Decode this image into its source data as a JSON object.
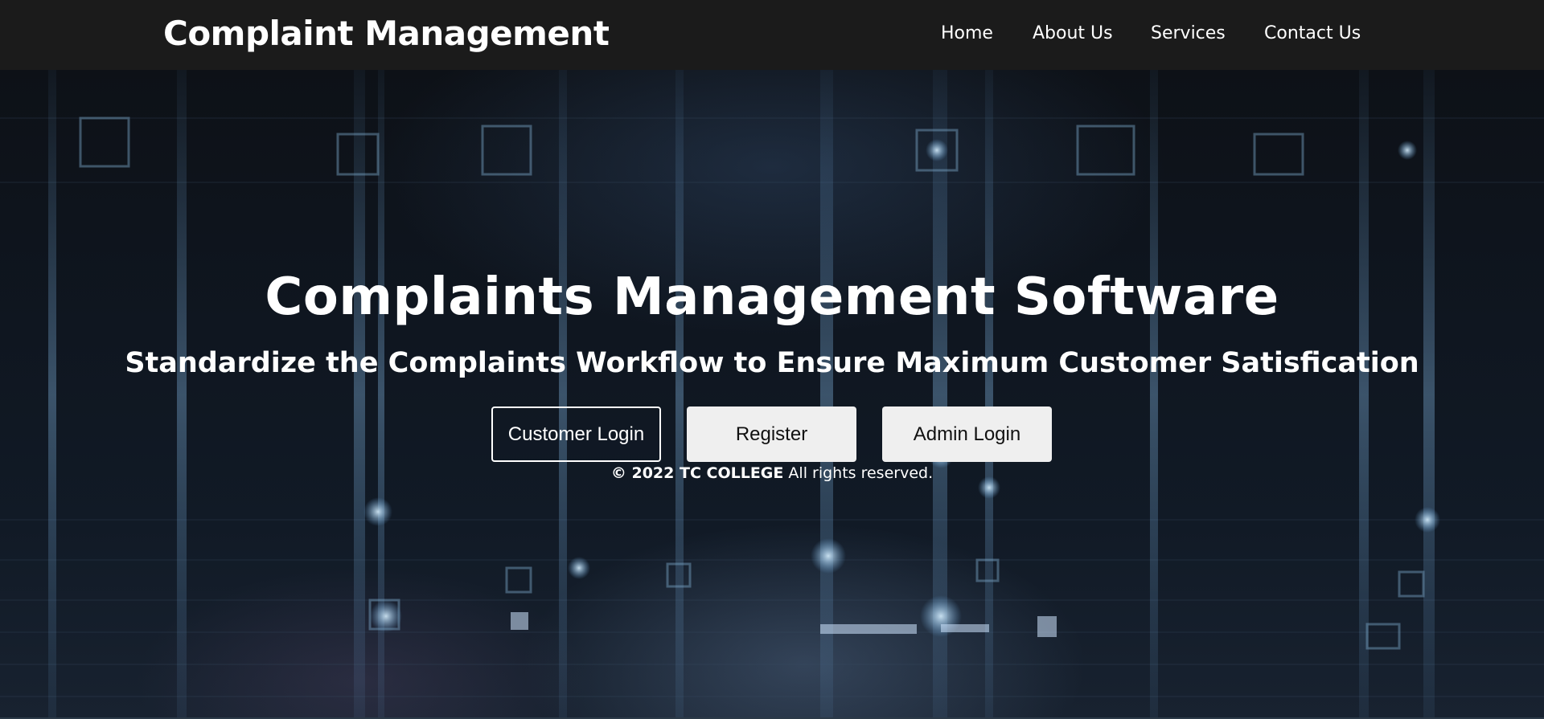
{
  "header": {
    "brand": "Complaint Management",
    "nav": [
      {
        "label": "Home"
      },
      {
        "label": "About Us"
      },
      {
        "label": "Services"
      },
      {
        "label": "Contact Us"
      }
    ]
  },
  "hero": {
    "title": "Complaints Management Software",
    "subtitle": "Standardize the Complaints Workflow to Ensure Maximum Customer Satisfication",
    "buttons": {
      "customer_login": "Customer Login",
      "register": "Register",
      "admin_login": "Admin Login"
    },
    "footer": {
      "copyright": "© 2022 TC COLLEGE",
      "rights": " All rights reserved."
    }
  },
  "colors": {
    "header_bg": "#1b1b1b",
    "text": "#ffffff",
    "button_bg": "#efefef",
    "hero_bg": "#0f1620"
  }
}
